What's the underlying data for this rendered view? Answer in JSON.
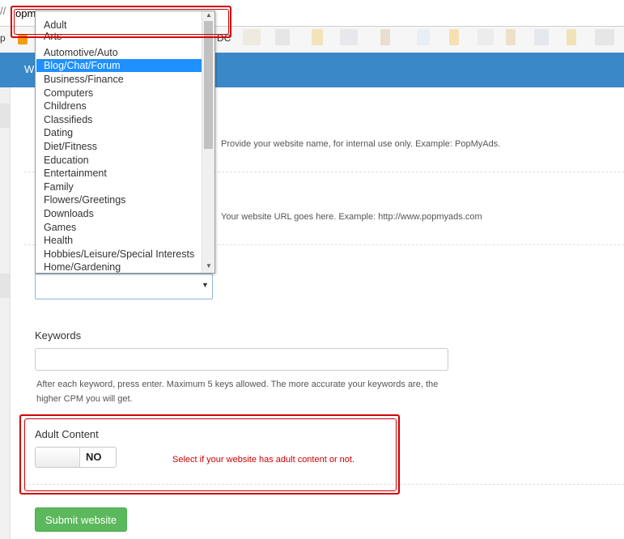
{
  "browser": {
    "address_prefix": "//",
    "address_text": "opm",
    "bookmark_left": "p",
    "bookmark_right": "DC"
  },
  "nav": {
    "label": "W"
  },
  "form": {
    "website_name_help": "Provide your website name, for internal use only. Example: PopMyAds.",
    "website_url_help": "Your website URL goes here. Example: http://www.popmyads.com",
    "category_value": "",
    "keywords": {
      "label": "Keywords",
      "value": "",
      "help": "After each keyword, press enter. Maximum 5 keys allowed. The more accurate your keywords are, the higher CPM you will get."
    },
    "adult": {
      "label": "Adult Content",
      "toggle_value": "NO",
      "help": "Select if your website has adult content or not."
    },
    "submit_label": "Submit website"
  },
  "dropdown": {
    "highlighted": "Adult",
    "selected": "Blog/Chat/Forum",
    "options": [
      "Arts",
      "Automotive/Auto",
      "Blog/Chat/Forum",
      "Business/Finance",
      "Computers",
      "Childrens",
      "Classifieds",
      "Dating",
      "Diet/Fitness",
      "Education",
      "Entertainment",
      "Family",
      "Flowers/Greetings",
      "Downloads",
      "Games",
      "Health",
      "Hobbies/Leisure/Special Interests",
      "Home/Gardening"
    ]
  },
  "colors": {
    "header_blue": "#3b88c8",
    "selection_blue": "#1e90ff",
    "submit_green": "#5cb85c",
    "annotation_red": "#d00000",
    "help_red": "#cc0000"
  }
}
